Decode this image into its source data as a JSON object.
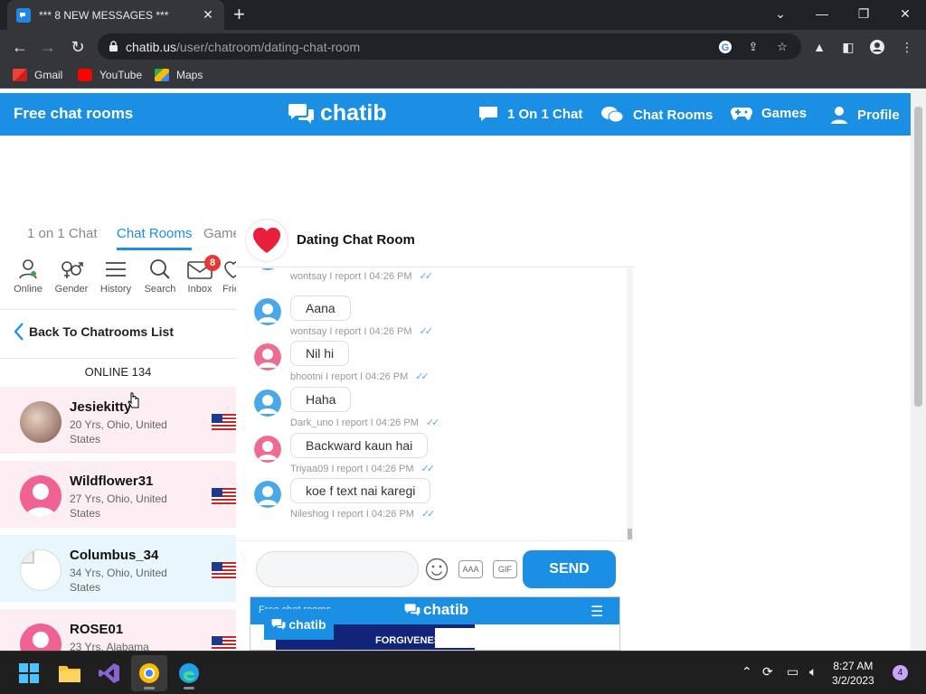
{
  "browser": {
    "tab_title": "*** 8 NEW MESSAGES ***",
    "url_host": "chatib.us",
    "url_path": "/user/chatroom/dating-chat-room",
    "bookmarks": [
      {
        "label": "Gmail",
        "icon": "gmail-icon"
      },
      {
        "label": "YouTube",
        "icon": "youtube-icon"
      },
      {
        "label": "Maps",
        "icon": "maps-icon"
      }
    ]
  },
  "site": {
    "tagline": "Free chat rooms",
    "logo": "chatib",
    "nav": [
      {
        "label": "1 On 1 Chat",
        "icon": "chat-bubble-icon"
      },
      {
        "label": "Chat Rooms",
        "icon": "chat-rooms-icon"
      },
      {
        "label": "Games",
        "icon": "gamepad-icon"
      },
      {
        "label": "Profile",
        "icon": "profile-icon"
      }
    ],
    "accent": "#1a8fe3"
  },
  "left": {
    "tabs": [
      "1 on 1 Chat",
      "Chat Rooms",
      "Games"
    ],
    "active_tab": "Chat Rooms",
    "icons": [
      {
        "label": "Online",
        "icon": "online-icon"
      },
      {
        "label": "Gender",
        "icon": "gender-icon"
      },
      {
        "label": "History",
        "icon": "history-icon"
      },
      {
        "label": "Search",
        "icon": "search-icon"
      },
      {
        "label": "Inbox",
        "icon": "inbox-icon",
        "badge": "8"
      },
      {
        "label": "Friends",
        "icon": "friends-icon"
      }
    ],
    "back_label": "Back To Chatrooms List",
    "online_label": "ONLINE 134",
    "users": [
      {
        "name": "Jesiekitty",
        "info": "20 Yrs, Ohio, United States",
        "gender": "female",
        "avatar": "photo"
      },
      {
        "name": "Wildflower31",
        "info": "27 Yrs, Ohio, United States",
        "gender": "female",
        "avatar": "default"
      },
      {
        "name": "Columbus_34",
        "info": "34 Yrs, Ohio, United States",
        "gender": "male",
        "avatar": "broken"
      },
      {
        "name": "ROSE01",
        "info": "23 Yrs, Alabama",
        "gender": "female",
        "avatar": "default"
      }
    ]
  },
  "chat": {
    "room_title": "Dating Chat Room",
    "messages": [
      {
        "text": "",
        "meta": "wontsay I report I 04:26 PM",
        "gender": "male"
      },
      {
        "text": "Aana",
        "meta": "wontsay I report I 04:26 PM",
        "gender": "male"
      },
      {
        "text": "Nil hi",
        "meta": "bhootni I report I 04:26 PM",
        "gender": "female"
      },
      {
        "text": "Haha",
        "meta": "Dark_uno I report I 04:26 PM",
        "gender": "male"
      },
      {
        "text": "Backward kaun hai",
        "meta": "Triyaa09 I report I 04:26 PM",
        "gender": "female"
      },
      {
        "text": "koe f text nai karegi",
        "meta": "Nileshog I report I 04:26 PM",
        "gender": "male"
      }
    ],
    "input_value": "",
    "font_button": "AAA",
    "gif_button": "GIF",
    "send_label": "SEND"
  },
  "ad": {
    "bar_left": "Free chat rooms",
    "logo": "chatib",
    "headline": "FORGIVENESS",
    "badge": "chatib"
  },
  "taskbar": {
    "time": "8:27 AM",
    "date": "3/2/2023",
    "notifications": "4"
  }
}
